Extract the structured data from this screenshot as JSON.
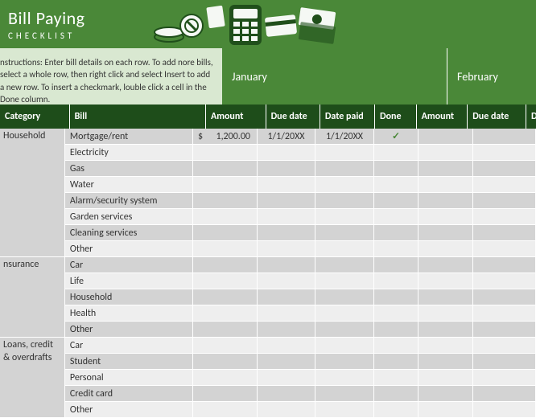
{
  "header": {
    "title": "Bill Paying",
    "subtitle": "CHECKLIST"
  },
  "instructions": "nstructions: Enter bill details on each row. To add nore bills, select a whole row, then right click and select Insert to add a new row. To insert a checkmark, louble click a cell in the Done column.",
  "months": {
    "m1": "January",
    "m2": "February"
  },
  "columns": {
    "category": "Category",
    "bill": "Bill",
    "amount": "Amount",
    "due": "Due date",
    "paid": "Date paid",
    "done": "Done",
    "amount2": "Amount",
    "due2": "Due date",
    "paid2": "Date p"
  },
  "categories": [
    {
      "name": "Household",
      "rows": 8,
      "bills": [
        "Mortgage/rent",
        "Electricity",
        "Gas",
        "Water",
        "Alarm/security system",
        "Garden services",
        "Cleaning services",
        "Other"
      ]
    },
    {
      "name": "nsurance",
      "rows": 5,
      "bills": [
        "Car",
        "Life",
        "Household",
        "Health",
        "Other"
      ]
    },
    {
      "name": "Loans, credit & overdrafts",
      "rows": 5,
      "bills": [
        "Car",
        "Student",
        "Personal",
        "Credit card",
        "Other"
      ]
    }
  ],
  "data": {
    "row0": {
      "currency": "$",
      "amount": "1,200.00",
      "due": "1/1/20XX",
      "paid": "1/1/20XX",
      "done": "✓"
    }
  }
}
